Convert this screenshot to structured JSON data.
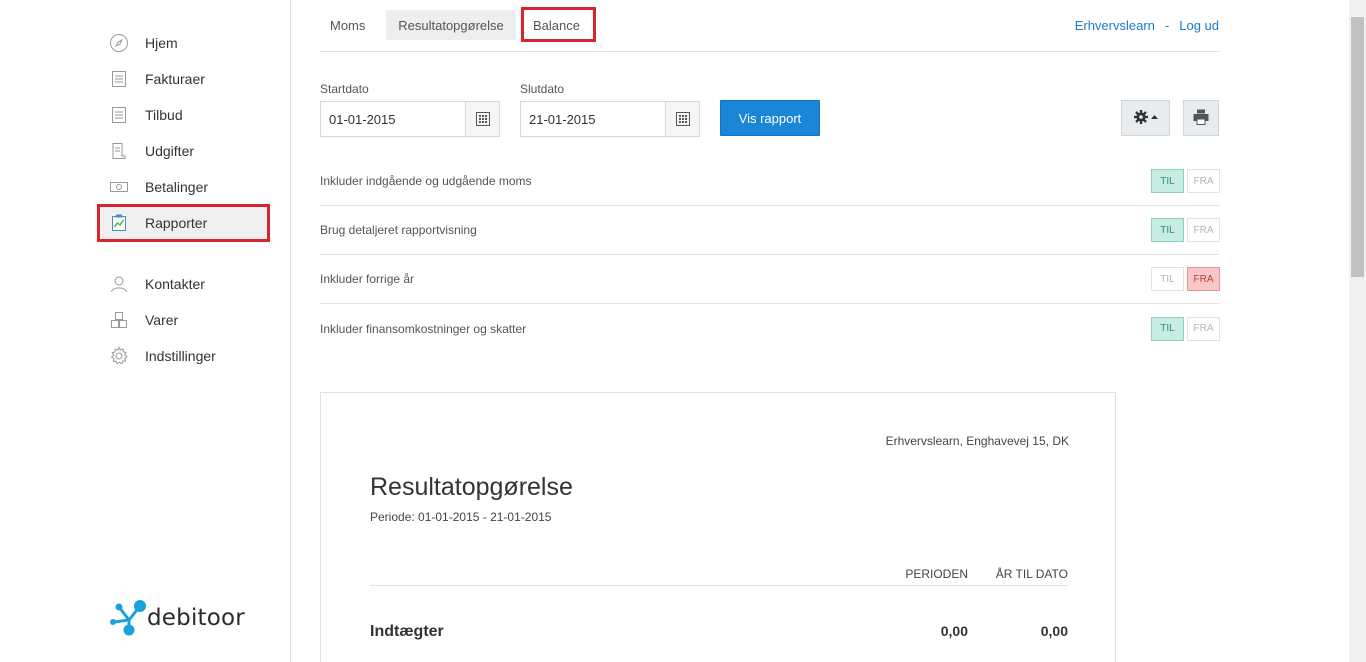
{
  "sidebar": {
    "items": [
      {
        "label": "Hjem",
        "icon": "compass-icon"
      },
      {
        "label": "Fakturaer",
        "icon": "document-icon"
      },
      {
        "label": "Tilbud",
        "icon": "document-icon"
      },
      {
        "label": "Udgifter",
        "icon": "receipt-icon"
      },
      {
        "label": "Betalinger",
        "icon": "banknote-icon"
      },
      {
        "label": "Rapporter",
        "icon": "chart-clipboard-icon"
      },
      {
        "label": "Kontakter",
        "icon": "person-icon"
      },
      {
        "label": "Varer",
        "icon": "boxes-icon"
      },
      {
        "label": "Indstillinger",
        "icon": "gear-icon"
      }
    ],
    "active": "Rapporter",
    "logo_text": "debitoor"
  },
  "tabs": [
    {
      "label": "Moms"
    },
    {
      "label": "Resultatopgørelse",
      "active": true
    },
    {
      "label": "Balance"
    }
  ],
  "toplinks": {
    "company": "Erhvervslearn",
    "separator": "-",
    "logout": "Log ud"
  },
  "filters": {
    "start_label": "Startdato",
    "start_value": "01-01-2015",
    "end_label": "Slutdato",
    "end_value": "21-01-2015",
    "submit": "Vis rapport"
  },
  "options": [
    {
      "label": "Inkluder indgående og udgående moms",
      "til": "TIL",
      "fra": "FRA",
      "state": "TIL"
    },
    {
      "label": "Brug detaljeret rapportvisning",
      "til": "TIL",
      "fra": "FRA",
      "state": "TIL"
    },
    {
      "label": "Inkluder forrige år",
      "til": "TIL",
      "fra": "FRA",
      "state": "FRA"
    },
    {
      "label": "Inkluder finansomkostninger og skatter",
      "til": "TIL",
      "fra": "FRA",
      "state": "TIL"
    }
  ],
  "report": {
    "company": "Erhvervslearn, Enghavevej 15, DK",
    "title": "Resultatopgørelse",
    "period": "Periode: 01-01-2015 - 21-01-2015",
    "col_period": "PERIODEN",
    "col_ytd": "ÅR TIL DATO",
    "rows": [
      {
        "name": "Indtægter",
        "period": "0,00",
        "ytd": "0,00"
      }
    ]
  },
  "colors": {
    "accent": "#1a86d8",
    "highlight": "#d9232d",
    "toggle_on": "#c7ece1",
    "toggle_off": "#f9c7c7"
  }
}
